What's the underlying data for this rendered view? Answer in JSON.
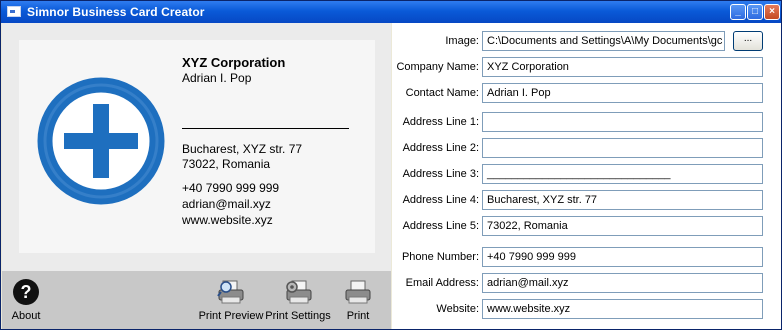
{
  "window": {
    "title": "Simnor Business Card Creator",
    "minimize_glyph": "_",
    "maximize_glyph": "□",
    "close_glyph": "×"
  },
  "card": {
    "company": "XYZ Corporation",
    "contact": "Adrian I. Pop",
    "address1": "Bucharest, XYZ str. 77",
    "address2": "73022, Romania",
    "phone": "+40 7990 999 999",
    "email": "adrian@mail.xyz",
    "website": "www.website.xyz",
    "logo_icon": "plus-circle-icon",
    "logo_color": "#1e6fbf"
  },
  "toolbar": {
    "about": "About",
    "about_glyph": "?",
    "print_preview": "Print Preview",
    "print_settings": "Print Settings",
    "print": "Print"
  },
  "form": {
    "labels": {
      "image": "Image:",
      "company": "Company Name:",
      "contact": "Contact Name:",
      "address1": "Address Line 1:",
      "address2": "Address Line 2:",
      "address3": "Address Line 3:",
      "address4": "Address Line 4:",
      "address5": "Address Line 5:",
      "phone": "Phone Number:",
      "email": "Email Address:",
      "website": "Website:"
    },
    "values": {
      "image": "C:\\Documents and Settings\\A\\My Documents\\gc",
      "company": "XYZ Corporation",
      "contact": "Adrian I. Pop",
      "address1": "",
      "address2": "",
      "address3": "______________________________",
      "address4": "Bucharest, XYZ str. 77",
      "address5": "73022, Romania",
      "phone": "+40 7990 999 999",
      "email": "adrian@mail.xyz",
      "website": "www.website.xyz"
    },
    "browse_label": "..."
  }
}
